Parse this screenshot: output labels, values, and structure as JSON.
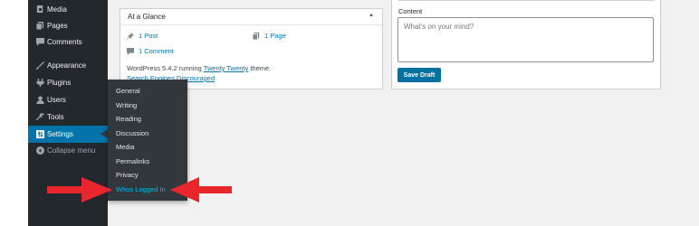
{
  "sidebar": {
    "items": [
      {
        "label": "Media",
        "icon": "media-icon"
      },
      {
        "label": "Pages",
        "icon": "pages-icon"
      },
      {
        "label": "Comments",
        "icon": "comments-icon"
      },
      {
        "label": "Appearance",
        "icon": "appearance-icon"
      },
      {
        "label": "Plugins",
        "icon": "plugins-icon"
      },
      {
        "label": "Users",
        "icon": "users-icon"
      },
      {
        "label": "Tools",
        "icon": "tools-icon"
      },
      {
        "label": "Settings",
        "icon": "settings-icon"
      },
      {
        "label": "Collapse menu",
        "icon": "collapse-icon"
      }
    ],
    "submenu": [
      "General",
      "Writing",
      "Reading",
      "Discussion",
      "Media",
      "Permalinks",
      "Privacy",
      "Whos Logged In"
    ]
  },
  "glance": {
    "title": "At a Glance",
    "posts": "1 Post",
    "pages": "1 Page",
    "comments": "1 Comment",
    "wp_prefix": "WordPress 5.4.2 running ",
    "theme": "Twenty Twenty",
    "wp_suffix": " theme.",
    "search_engines": "Search Engines Discouraged"
  },
  "quickdraft": {
    "content_label": "Content",
    "content_placeholder": "What’s on your mind?",
    "save_label": "Save Draft"
  },
  "colors": {
    "sidebar_bg": "#23282d",
    "submenu_bg": "#32373c",
    "active": "#0073aa",
    "highlight": "#00b9eb",
    "arrow": "#e8262b"
  }
}
